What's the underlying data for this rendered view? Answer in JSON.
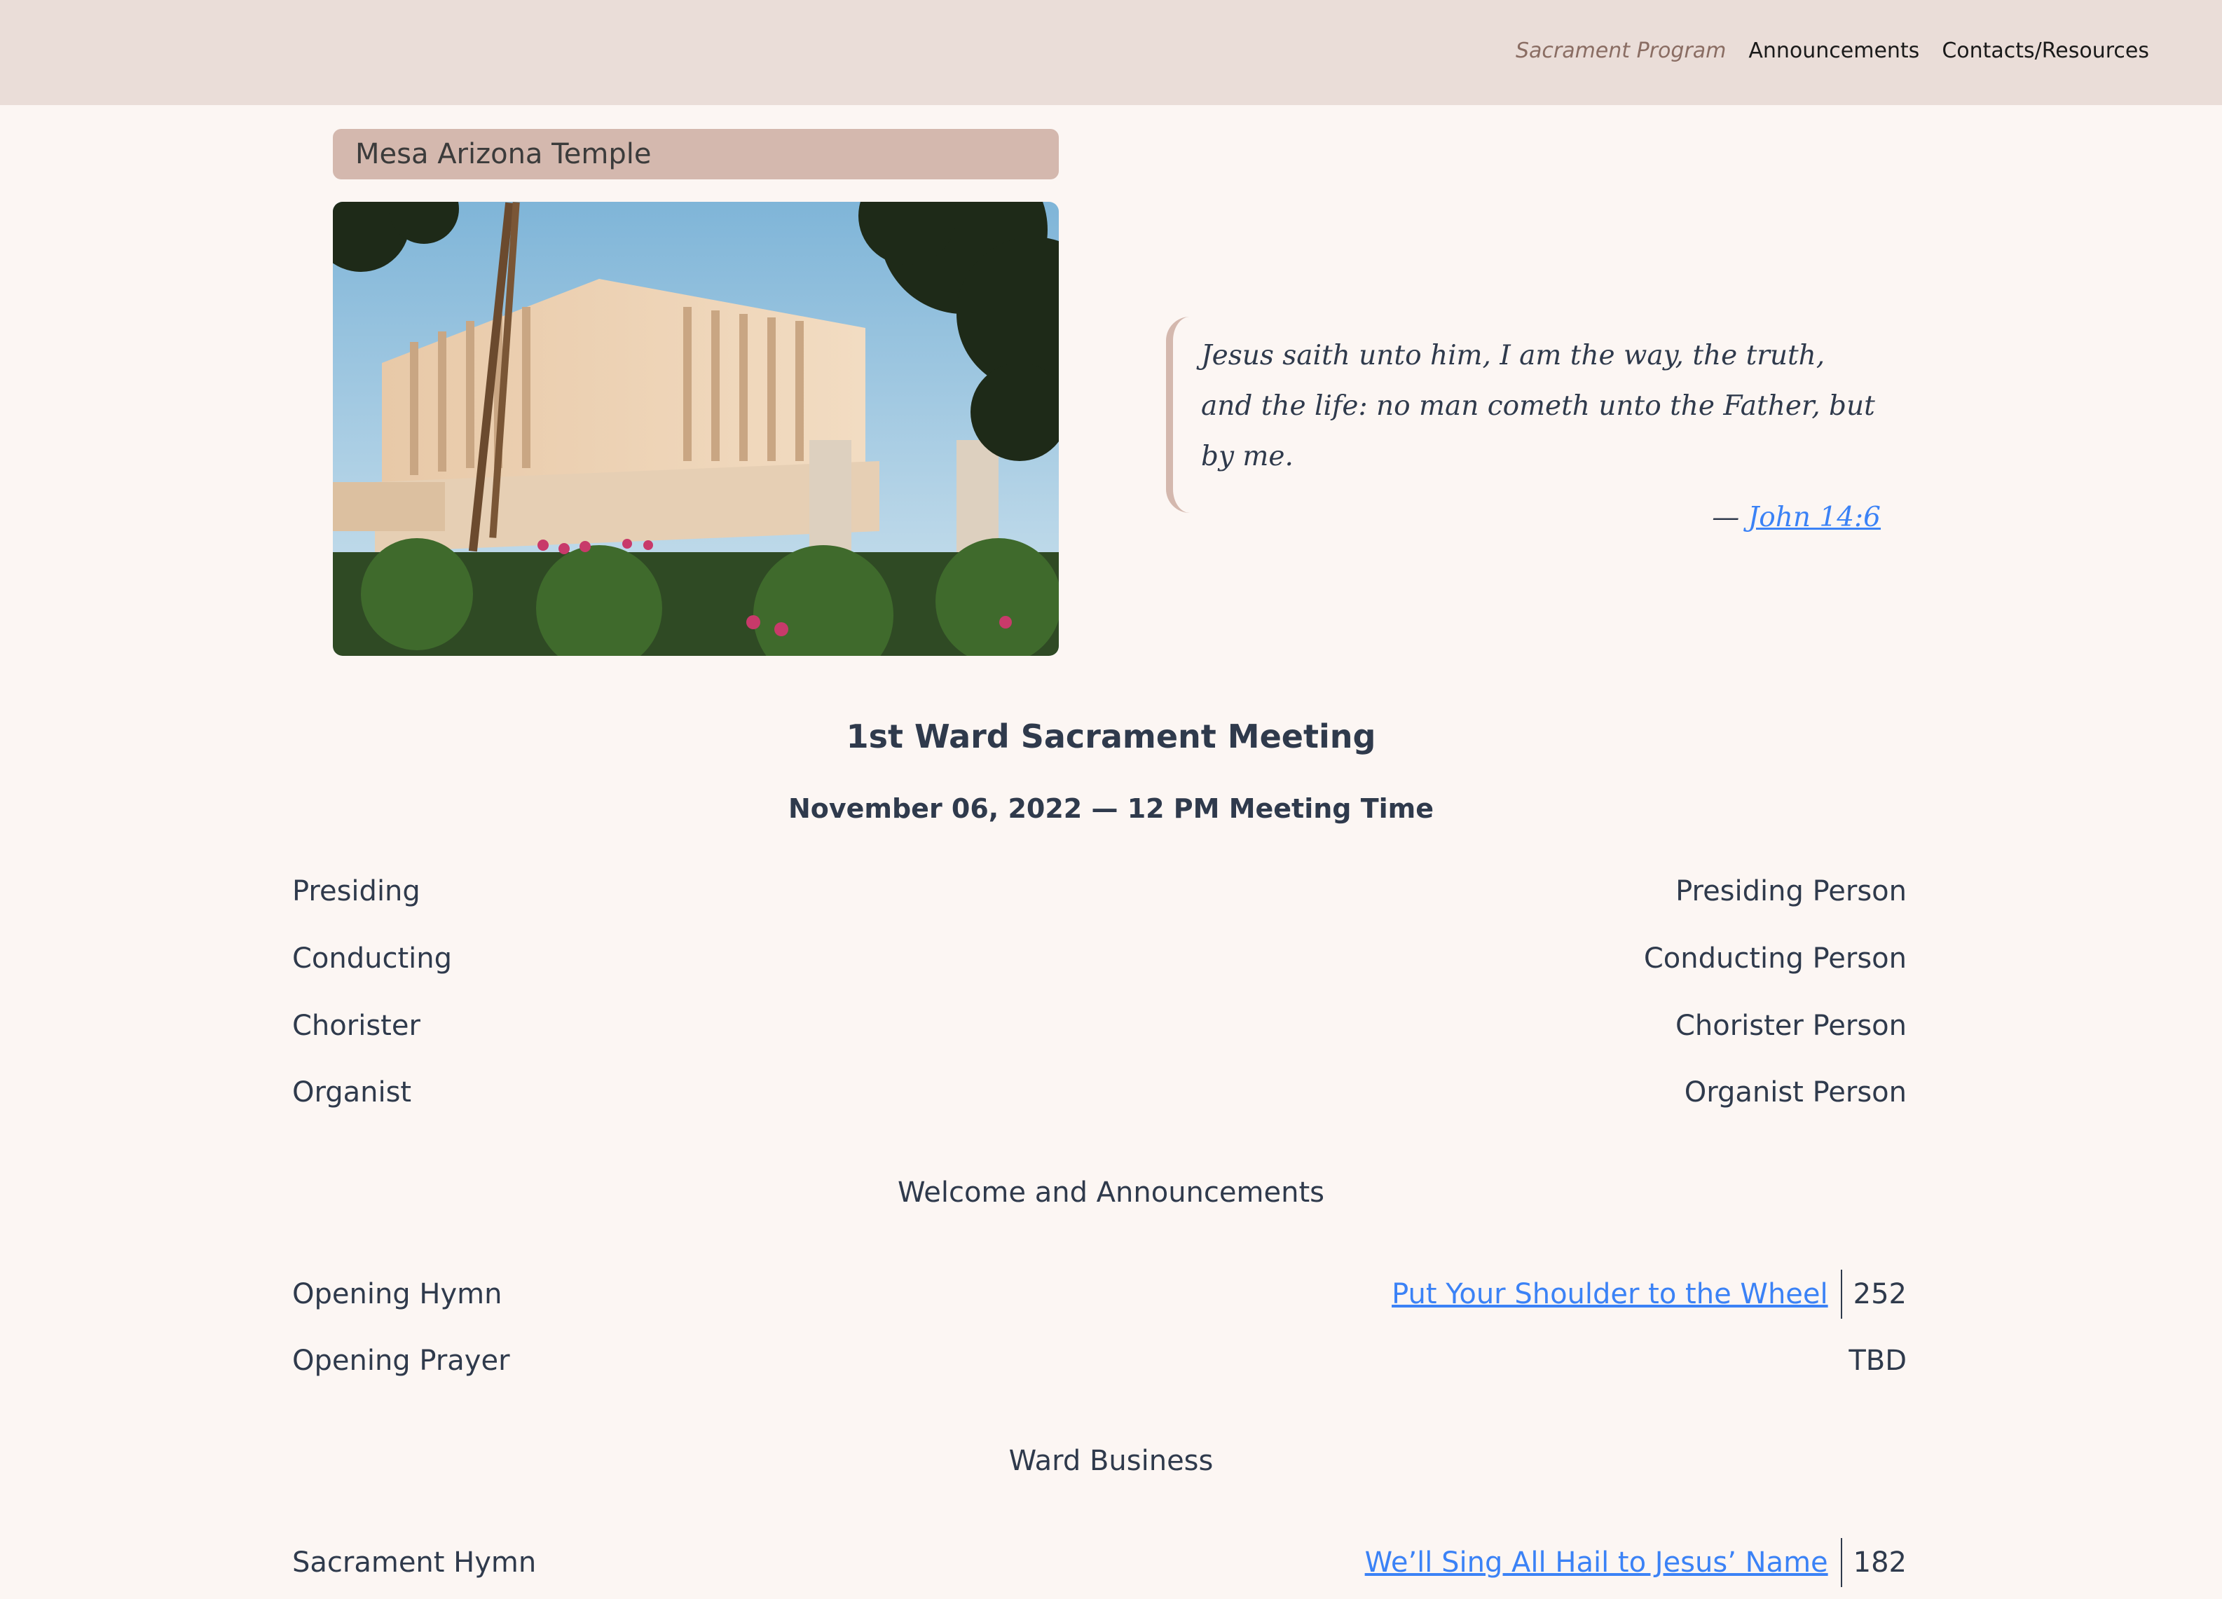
{
  "nav": {
    "items": [
      {
        "label": "Sacrament Program"
      },
      {
        "label": "Announcements"
      },
      {
        "label": "Contacts/Resources"
      }
    ]
  },
  "temple": {
    "label": "Mesa Arizona Temple"
  },
  "quote": {
    "text": "Jesus saith unto him, I am the way, the truth, and the life: no man cometh unto the Father, but by me.",
    "dash": "—",
    "reference": "John 14:6"
  },
  "meeting": {
    "title": "1st Ward Sacrament Meeting",
    "date_line": "November 06, 2022 — 12 PM Meeting Time"
  },
  "roles": [
    {
      "label": "Presiding",
      "value": "Presiding Person"
    },
    {
      "label": "Conducting",
      "value": "Conducting Person"
    },
    {
      "label": "Chorister",
      "value": "Chorister Person"
    },
    {
      "label": "Organist",
      "value": "Organist Person"
    }
  ],
  "sections": {
    "welcome": "Welcome and Announcements",
    "business": "Ward Business"
  },
  "program": {
    "opening_hymn": {
      "label": "Opening Hymn",
      "title": "Put Your Shoulder to the Wheel",
      "number": "252"
    },
    "opening_prayer": {
      "label": "Opening Prayer",
      "value": "TBD"
    },
    "sacrament_hymn": {
      "label": "Sacrament Hymn",
      "title": "We’ll Sing All Hail to Jesus’ Name",
      "number": "182"
    }
  },
  "colors": {
    "background": "#fcf6f3",
    "header": "#eaddd8",
    "accent": "#d4b8ae",
    "link": "#3b82f6",
    "text": "#2f3a4c"
  }
}
